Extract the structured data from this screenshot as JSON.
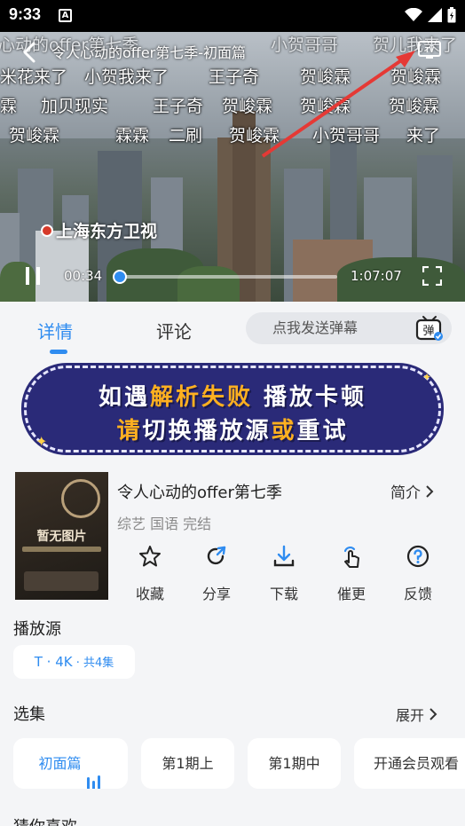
{
  "status_bar": {
    "time": "9:33",
    "notification_badge": "A"
  },
  "player": {
    "title": "令人心动的offer第七季-初面篇",
    "watermark": "上海东方卫视",
    "current_time": "00:34",
    "duration": "1:07:07",
    "progress_fraction": 0.02,
    "danmaku": [
      {
        "text": "令人心动的offer第七季",
        "row": 0,
        "col": 0
      },
      {
        "text": "小贺哥哥",
        "row": 0,
        "col": 1
      },
      {
        "text": "贺儿我来了",
        "row": 0,
        "col": 2
      },
      {
        "text": "米花来了",
        "row": 1,
        "col": 0
      },
      {
        "text": "小贺我来了",
        "row": 1,
        "col": 1
      },
      {
        "text": "王子奇",
        "row": 1,
        "col": 2
      },
      {
        "text": "贺峻霖",
        "row": 1,
        "col": 3
      },
      {
        "text": "贺峻霖",
        "row": 1,
        "col": 4
      },
      {
        "text": "霖",
        "row": 2,
        "col": 0
      },
      {
        "text": "加贝现实",
        "row": 2,
        "col": 1
      },
      {
        "text": "王子奇",
        "row": 2,
        "col": 2
      },
      {
        "text": "贺峻霖",
        "row": 2,
        "col": 3
      },
      {
        "text": "贺峻霖",
        "row": 2,
        "col": 4
      },
      {
        "text": "贺峻霖",
        "row": 2,
        "col": 5
      },
      {
        "text": "贺峻霖",
        "row": 3,
        "col": 0
      },
      {
        "text": "霖霖",
        "row": 3,
        "col": 1
      },
      {
        "text": "二刷",
        "row": 3,
        "col": 2
      },
      {
        "text": "贺峻霖",
        "row": 3,
        "col": 3
      },
      {
        "text": "小贺哥哥",
        "row": 3,
        "col": 4
      },
      {
        "text": "来了",
        "row": 3,
        "col": 5
      }
    ]
  },
  "tabs": {
    "details": "详情",
    "comments": "评论",
    "danmaku_placeholder": "点我发送弹幕",
    "danmaku_toggle": "弹"
  },
  "banner": {
    "line1_a": "如遇",
    "line1_b": "解析失败",
    "line1_c": " 播放卡顿",
    "line2_a": "请",
    "line2_b": "切换播放源",
    "line2_c": "或",
    "line2_d": "重试"
  },
  "show": {
    "title": "令人心动的offer第七季",
    "meta": "综艺 国语 完结",
    "intro": "简介",
    "poster_text": "暂无图片"
  },
  "actions": [
    {
      "label": "收藏",
      "icon": "star-icon"
    },
    {
      "label": "分享",
      "icon": "share-icon"
    },
    {
      "label": "下载",
      "icon": "download-icon"
    },
    {
      "label": "催更",
      "icon": "tap-icon"
    },
    {
      "label": "反馈",
      "icon": "question-icon"
    }
  ],
  "sources": {
    "title": "播放源",
    "selected_main": "T · 4K",
    "selected_count": " · 共4集"
  },
  "episodes": {
    "title": "选集",
    "expand": "展开",
    "items": [
      "初面篇",
      "第1期上",
      "第1期中",
      "开通会员观看"
    ]
  },
  "recommend": {
    "title": "猜你喜欢"
  },
  "colors": {
    "accent": "#2f8cf0",
    "banner_bg": "#2a2a78",
    "banner_highlight": "#ffb020",
    "arrow": "#e53935"
  }
}
